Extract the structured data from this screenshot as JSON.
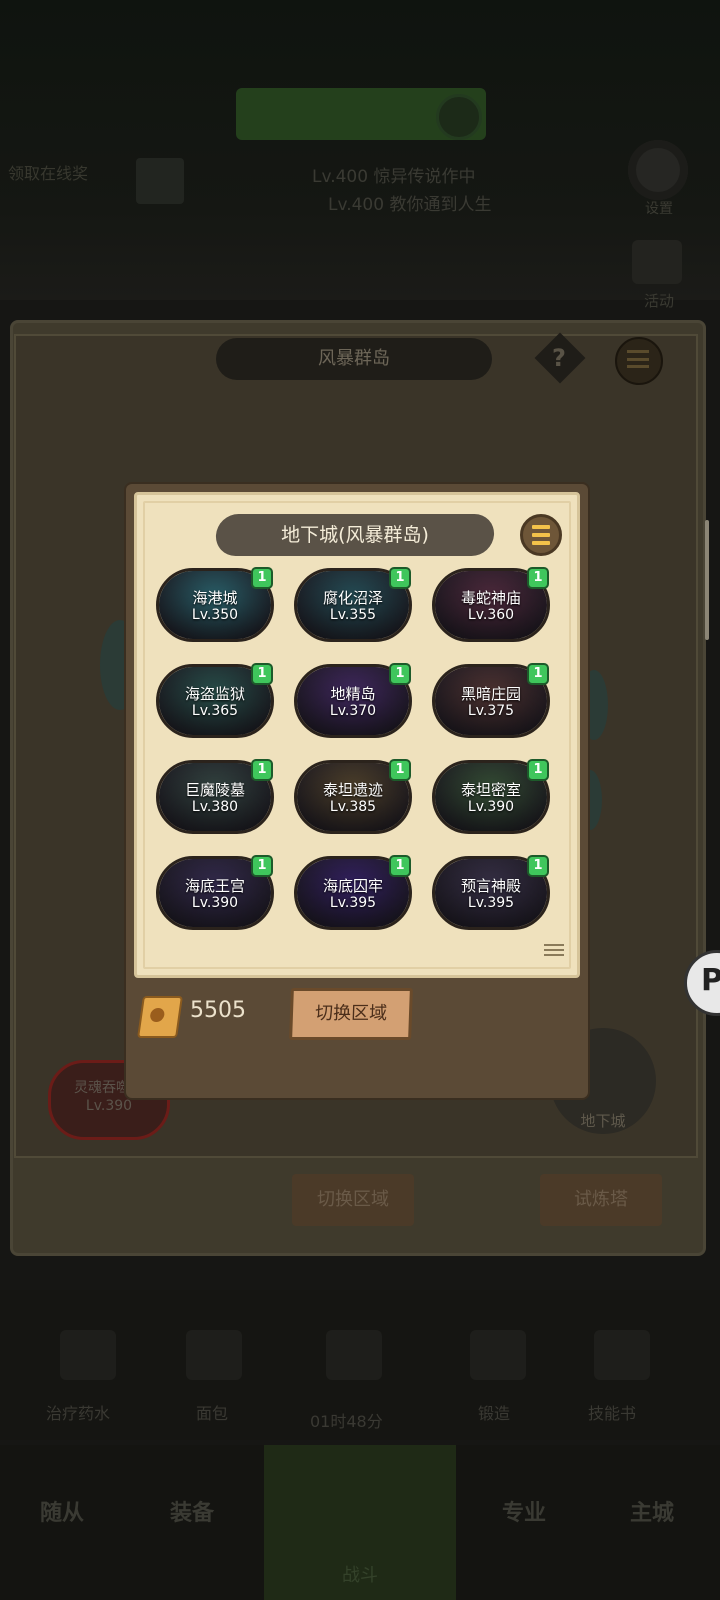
{
  "background": {
    "top_green_bar": "",
    "left_label": "领取在线奖",
    "top_lines": [
      "Lv.400 惊异传说作中",
      "Lv.400 教你通到人生"
    ],
    "gear_label": "设置",
    "event_label": "活动",
    "region_title": "风暴群岛",
    "help_glyph": "?",
    "boss": {
      "name": "灵魂吞噬者",
      "level": "Lv.390"
    },
    "dungeon_label": "地下城",
    "bottom_buttons": [
      "切换区域",
      "试炼塔"
    ],
    "shortcut_items": [
      "治疗药水",
      "面包",
      "01时48分",
      "锻造",
      "技能书"
    ],
    "nav_tabs": [
      "随从",
      "装备",
      "战斗",
      "专业",
      "主城"
    ]
  },
  "popup": {
    "title": "地下城(风暴群岛)",
    "dungeons": [
      {
        "name": "海港城",
        "level": "Lv.350",
        "badge": "1",
        "color": "#2f6f7a"
      },
      {
        "name": "腐化沼泽",
        "level": "Lv.355",
        "badge": "1",
        "color": "#2a5a64"
      },
      {
        "name": "毒蛇神庙",
        "level": "Lv.360",
        "badge": "1",
        "color": "#5a2f45"
      },
      {
        "name": "海盗监狱",
        "level": "Lv.365",
        "badge": "1",
        "color": "#2d5c56"
      },
      {
        "name": "地精岛",
        "level": "Lv.370",
        "badge": "1",
        "color": "#4a2d6e"
      },
      {
        "name": "黑暗庄园",
        "level": "Lv.375",
        "badge": "1",
        "color": "#5a3a38"
      },
      {
        "name": "巨魔陵墓",
        "level": "Lv.380",
        "badge": "1",
        "color": "#3a4e4a"
      },
      {
        "name": "泰坦遗迹",
        "level": "Lv.385",
        "badge": "1",
        "color": "#5a4a30"
      },
      {
        "name": "泰坦密室",
        "level": "Lv.390",
        "badge": "1",
        "color": "#3c5a3c"
      },
      {
        "name": "海底王宫",
        "level": "Lv.390",
        "badge": "1",
        "color": "#3a3058"
      },
      {
        "name": "海底囚牢",
        "level": "Lv.395",
        "badge": "1",
        "color": "#3a2470"
      },
      {
        "name": "预言神殿",
        "level": "Lv.395",
        "badge": "1",
        "color": "#3e3650"
      }
    ],
    "currency_value": "5505",
    "switch_button": "切换区域"
  }
}
